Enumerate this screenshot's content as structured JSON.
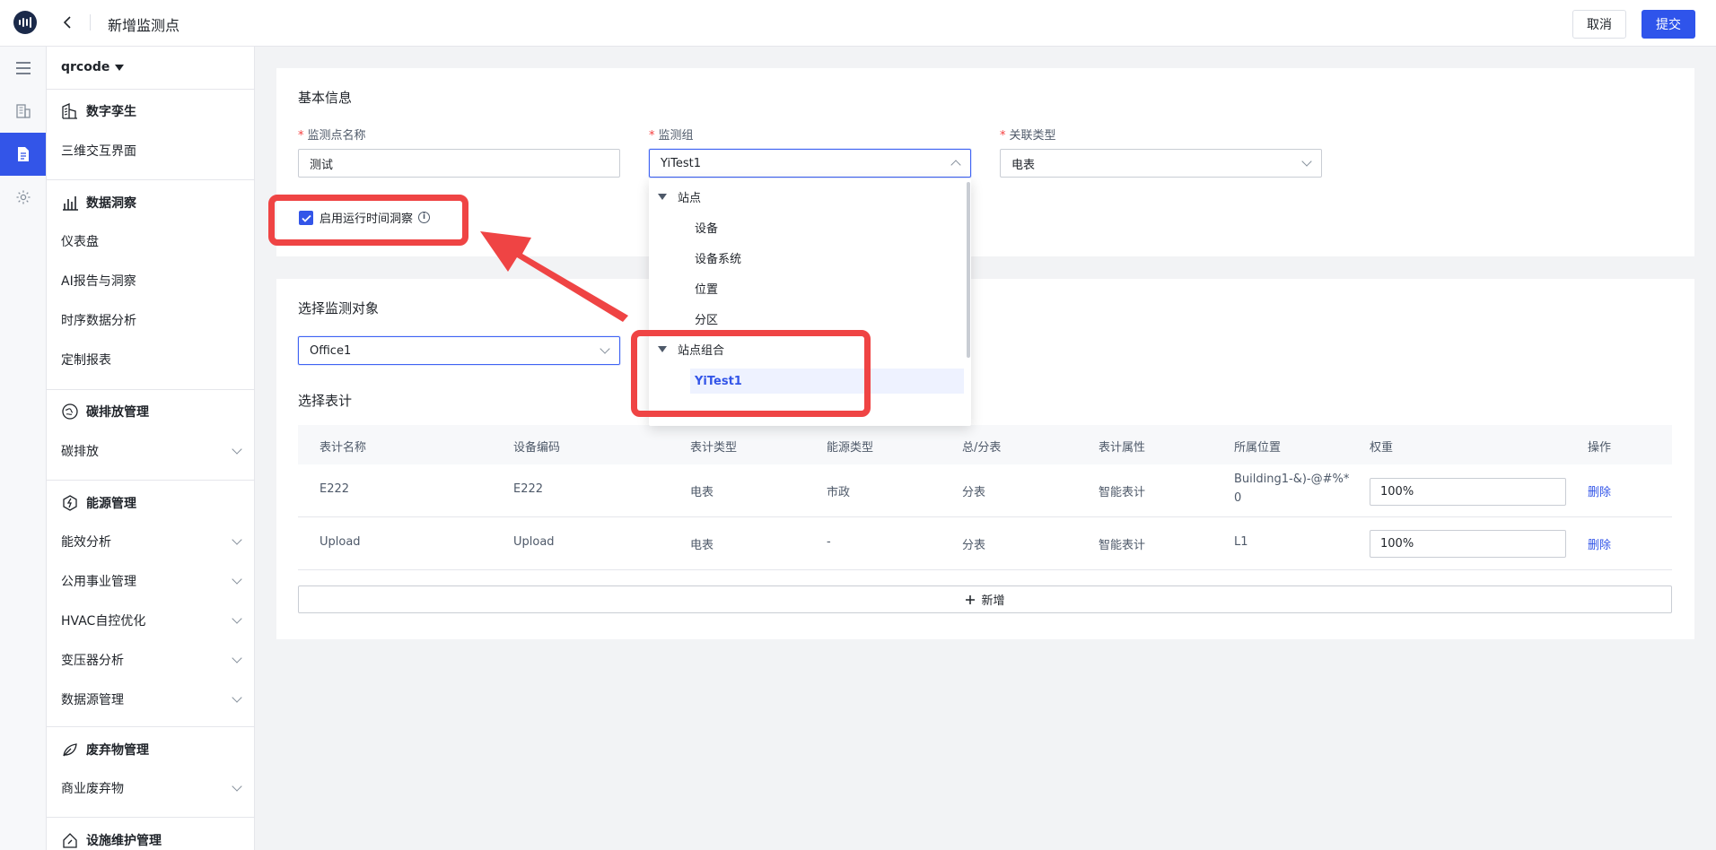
{
  "header": {
    "title": "新增监测点",
    "cancel_label": "取消",
    "submit_label": "提交"
  },
  "sidebar": {
    "project": "qrcode",
    "sections": [
      {
        "title": "数字孪生",
        "icon": "digital-twin-icon",
        "items": [
          {
            "label": "三维交互界面",
            "expandable": false
          }
        ]
      },
      {
        "title": "数据洞察",
        "icon": "bar-chart-icon",
        "items": [
          {
            "label": "仪表盘",
            "expandable": false
          },
          {
            "label": "AI报告与洞察",
            "expandable": false
          },
          {
            "label": "时序数据分析",
            "expandable": false
          },
          {
            "label": "定制报表",
            "expandable": false
          }
        ]
      },
      {
        "title": "碳排放管理",
        "icon": "carbon-icon",
        "items": [
          {
            "label": "碳排放",
            "expandable": true
          }
        ]
      },
      {
        "title": "能源管理",
        "icon": "energy-icon",
        "items": [
          {
            "label": "能效分析",
            "expandable": true
          },
          {
            "label": "公用事业管理",
            "expandable": true
          },
          {
            "label": "HVAC自控优化",
            "expandable": true
          },
          {
            "label": "变压器分析",
            "expandable": true
          },
          {
            "label": "数据源管理",
            "expandable": true
          }
        ]
      },
      {
        "title": "废弃物管理",
        "icon": "leaf-icon",
        "items": [
          {
            "label": "商业废弃物",
            "expandable": true
          }
        ]
      },
      {
        "title": "设施维护管理",
        "icon": "maintenance-icon",
        "items": []
      }
    ]
  },
  "basic": {
    "title": "基本信息",
    "name_label": "监测点名称",
    "name_value": "测试",
    "group_label": "监测组",
    "group_value": "YiTest1",
    "type_label": "关联类型",
    "type_value": "电表",
    "checkbox_label": "启用运行时间洞察",
    "checkbox_checked": true
  },
  "target": {
    "title": "选择监测对象",
    "value": "Office1"
  },
  "meters": {
    "title": "选择表计",
    "columns": [
      "表计名称",
      "设备编码",
      "表计类型",
      "能源类型",
      "总/分表",
      "表计属性",
      "所属位置",
      "权重",
      "操作"
    ],
    "rows": [
      {
        "name": "E222",
        "code": "E222",
        "meter_type": "电表",
        "energy": "市政",
        "total_sub": "分表",
        "attr": "智能表计",
        "loc1": "Building1-&)-@#%*",
        "loc2": "0",
        "weight": "100%",
        "action": "删除"
      },
      {
        "name": "Upload",
        "code": "Upload",
        "meter_type": "电表",
        "energy": "-",
        "total_sub": "分表",
        "attr": "智能表计",
        "loc1": "L1",
        "loc2": "",
        "weight": "100%",
        "action": "删除"
      }
    ],
    "add_label": "新增"
  },
  "dropdown": {
    "groups": [
      {
        "label": "站点",
        "children": [
          "设备",
          "设备系统",
          "位置",
          "分区"
        ]
      },
      {
        "label": "站点组合",
        "children": [
          "YiTest1"
        ],
        "selected": "YiTest1"
      }
    ]
  },
  "colors": {
    "primary": "#3355e8",
    "annotation": "#ef4444",
    "required": "#f53f3f"
  }
}
